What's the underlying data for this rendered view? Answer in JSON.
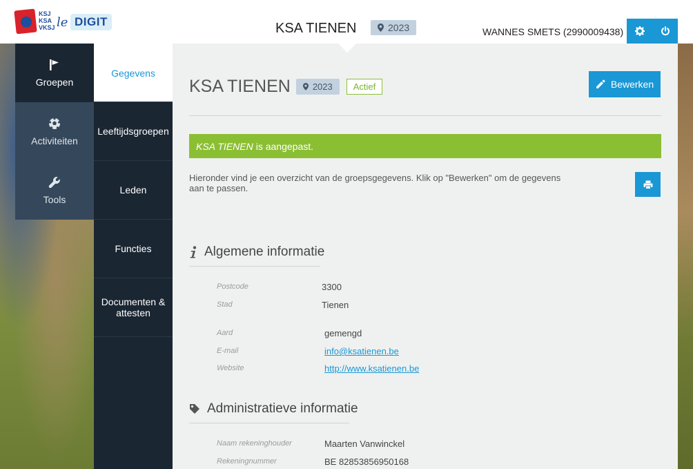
{
  "header": {
    "logo": {
      "lines": [
        "KSJ",
        "KSA",
        "VKSJ"
      ],
      "le": "le",
      "digit": "DIGIT"
    },
    "title": "KSA TIENEN",
    "year": "2023",
    "user": "WANNES SMETS (2990009438)",
    "settings_icon": "gear-icon",
    "logout_icon": "power-icon"
  },
  "main_nav": {
    "items": [
      {
        "label": "Groepen",
        "icon": "flag-icon",
        "active": true
      },
      {
        "label": "Activiteiten",
        "icon": "football-icon",
        "active": false
      },
      {
        "label": "Tools",
        "icon": "wrench-icon",
        "active": false
      }
    ]
  },
  "sub_nav": {
    "items": [
      {
        "label": "Gegevens",
        "active": true
      },
      {
        "label": "Leeftijdsgroepen",
        "active": false
      },
      {
        "label": "Leden",
        "active": false
      },
      {
        "label": "Functies",
        "active": false
      },
      {
        "label": "Documenten & attesten",
        "active": false
      }
    ]
  },
  "page": {
    "title": "KSA TIENEN",
    "year": "2023",
    "status": "Actief",
    "edit_label": "Bewerken",
    "alert": {
      "name": "KSA TIENEN",
      "text": "is aangepast."
    },
    "intro": "Hieronder vind je een overzicht van de groepsgegevens. Klik op \"Bewerken\" om de gegevens aan te passen."
  },
  "general": {
    "heading": "Algemene informatie",
    "postcode_label": "Postcode",
    "postcode": "3300",
    "city_label": "Stad",
    "city": "Tienen",
    "type_label": "Aard",
    "type": "gemengd",
    "email_label": "E-mail",
    "email": "info@ksatienen.be",
    "website_label": "Website",
    "website": "http://www.ksatienen.be"
  },
  "admin": {
    "heading": "Administratieve informatie",
    "holder_label": "Naam rekeninghouder",
    "holder": "Maarten Vanwinckel",
    "account_label": "Rekeningnummer",
    "account": "BE 82853856950168"
  },
  "colors": {
    "accent": "#1a97d5",
    "success": "#8bbf33",
    "nav_dark": "#1a2632",
    "nav_mid": "#35475a"
  }
}
